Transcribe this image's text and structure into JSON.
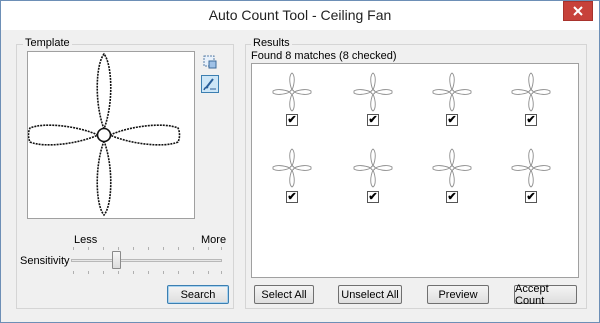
{
  "window": {
    "title": "Auto Count Tool - Ceiling Fan"
  },
  "template": {
    "group_label": "Template",
    "tools": [
      {
        "name": "select-region-icon",
        "active": false
      },
      {
        "name": "draw-brush-icon",
        "active": true
      }
    ]
  },
  "sensitivity": {
    "label": "Sensitivity",
    "less_label": "Less",
    "more_label": "More",
    "value": 0.3
  },
  "search_label": "Search",
  "results": {
    "group_label": "Results",
    "summary": "Found 8 matches (8 checked)",
    "items": [
      {
        "checked": true,
        "check_glyph": "✔"
      },
      {
        "checked": true,
        "check_glyph": "✔"
      },
      {
        "checked": true,
        "check_glyph": "✔"
      },
      {
        "checked": true,
        "check_glyph": "✔"
      },
      {
        "checked": true,
        "check_glyph": "✔"
      },
      {
        "checked": true,
        "check_glyph": "✔"
      },
      {
        "checked": true,
        "check_glyph": "✔"
      },
      {
        "checked": true,
        "check_glyph": "✔"
      }
    ]
  },
  "buttons": {
    "select_all": "Select All",
    "unselect_all": "Unselect All",
    "preview": "Preview",
    "accept_count": "Accept Count"
  },
  "colors": {
    "close": "#c7413a",
    "accent": "#3c7fb1"
  }
}
